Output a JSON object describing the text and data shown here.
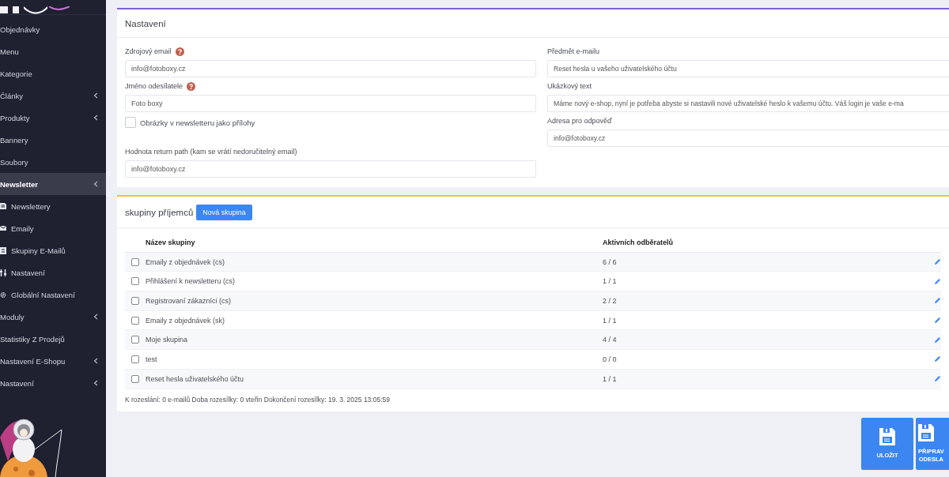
{
  "sidebar": {
    "items": [
      {
        "label": "Objednávky",
        "selected": false,
        "has_submenu": false
      },
      {
        "label": "Menu",
        "selected": false,
        "has_submenu": false
      },
      {
        "label": "Kategorie",
        "selected": false,
        "has_submenu": false
      },
      {
        "label": "Články",
        "selected": false,
        "has_submenu": true
      },
      {
        "label": "Produkty",
        "selected": false,
        "has_submenu": true
      },
      {
        "label": "Bannery",
        "selected": false,
        "has_submenu": false
      },
      {
        "label": "Soubory",
        "selected": false,
        "has_submenu": false
      },
      {
        "label": "Newsletter",
        "selected": true,
        "has_submenu": true,
        "children": [
          {
            "label": "Newslettery",
            "selected": false
          },
          {
            "label": "Emaily",
            "selected": false
          },
          {
            "label": "Skupiny E-Mailů",
            "selected": false
          },
          {
            "label": "Nastavení",
            "selected": false
          },
          {
            "label": "Globální Nastavení",
            "selected": false
          }
        ]
      },
      {
        "label": "Moduly",
        "selected": false,
        "has_submenu": true
      },
      {
        "label": "Statistiky Z Prodejů",
        "selected": false,
        "has_submenu": false
      },
      {
        "label": "Nastavení E-Shopu",
        "selected": false,
        "has_submenu": true
      },
      {
        "label": "Nastavení",
        "selected": false,
        "has_submenu": true
      }
    ]
  },
  "settings": {
    "title": "Nastavení",
    "left": [
      {
        "kind": "input",
        "label": "Zdrojový email",
        "help": true,
        "value": "info@fotoboxy.cz"
      },
      {
        "kind": "input",
        "label": "Jméno odesílatele",
        "help": true,
        "value": "Foto boxy"
      },
      {
        "kind": "checkbox",
        "label": "Obrázky v newsletteru jako přílohy",
        "checked": false
      },
      {
        "kind": "input",
        "label": "Hodnota return path (kam se vrátí nedoručitelný email)",
        "help": false,
        "value": "info@fotoboxy.cz"
      }
    ],
    "right": [
      {
        "kind": "input",
        "label": "Předmět e-mailu",
        "help": false,
        "value": "Reset hesla u vašeho uživatelského účtu"
      },
      {
        "kind": "input",
        "label": "Ukázkový text",
        "help": false,
        "value": "Máme nový e-shop, nyní je potřeba abyste si nastavili nové uživatelské heslo k vašemu účtu. Váš login je vaše e-ma"
      },
      {
        "kind": "input",
        "label": "Adresa pro odpověď",
        "help": false,
        "value": "info@fotoboxy.cz"
      }
    ]
  },
  "groups": {
    "title": "skupiny příjemců",
    "new_button": "Nová skupina",
    "columns": [
      "Název skupiny",
      "Aktivních odběratelů"
    ],
    "rows": [
      {
        "name": "Emaily z objednávek (cs)",
        "count": "6 / 6",
        "checked": false
      },
      {
        "name": "Přihlášení k newsletteru (cs)",
        "count": "1 / 1",
        "checked": false
      },
      {
        "name": "Registrovaní zákazníci (cs)",
        "count": "2 / 2",
        "checked": false
      },
      {
        "name": "Emaily z objednávek (sk)",
        "count": "1 / 1",
        "checked": false
      },
      {
        "name": "Moje skupina",
        "count": "4 / 4",
        "checked": false
      },
      {
        "name": "test",
        "count": "0 / 0",
        "checked": false
      },
      {
        "name": "Reset hesla uživatelského účtu",
        "count": "1 / 1",
        "checked": false
      }
    ],
    "footer": "K rozeslání: 0 e-mailů Doba rozesílky: 0 vteřin Dokončení rozesílky: 19. 3. 2025 13:05:59"
  },
  "actions": [
    {
      "label": "ULOŽIT"
    },
    {
      "label": "PŘIPRAV\nODESLA"
    }
  ]
}
